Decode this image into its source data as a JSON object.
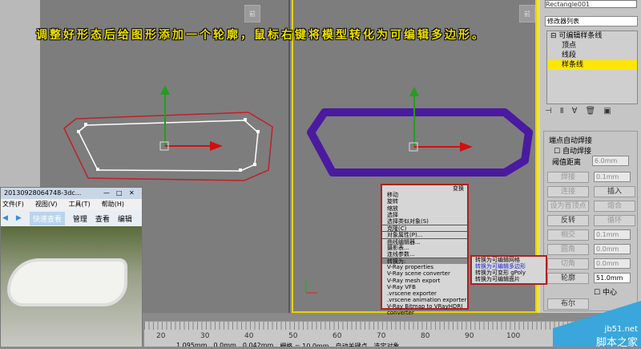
{
  "caption": "调整好形态后给图形添加一个轮廓，鼠标右键将模型转化为可编辑多边形。",
  "viewport_icon": "前",
  "panel": {
    "object_name": "Rectangle001",
    "modifier_list": "修改器列表",
    "stack": [
      {
        "label": "可编辑样条线"
      },
      {
        "label": "顶点"
      },
      {
        "label": "线段"
      },
      {
        "label": "样条线",
        "selected": true
      }
    ],
    "weld_group": "端点自动焊接",
    "auto_weld": "自动焊接",
    "threshold_label": "阈值距离",
    "threshold_value": "6.0mm",
    "buttons": {
      "weld": "焊接",
      "weld_val": "0.1mm",
      "connect": "连接",
      "insert": "插入",
      "make_first": "设为首顶点",
      "fuse": "熔合",
      "reverse": "反转",
      "cycle": "循环",
      "cross": "相交",
      "cross_val": "0.1mm",
      "fillet": "圆角",
      "fillet_val": "0.0mm",
      "chamfer": "切角",
      "chamfer_val": "0.0mm",
      "outline": "轮廓",
      "outline_val": "51.0mm",
      "center": "中心",
      "boolean": "布尔"
    }
  },
  "menu": {
    "header": "变换",
    "items": [
      "移动",
      "旋转",
      "缩放",
      "选择",
      "选择类似对象(S)",
      "克隆(C)",
      "对象属性(P)...",
      "曲线编辑器...",
      "摄影表...",
      "连线参数...",
      "转换为:",
      "V-Ray properties",
      "V-Ray scene converter",
      "V-Ray mesh export",
      "V-Ray VFB",
      ".vrscene exporter",
      ".vrscene animation exporter",
      "V-Ray Bitmap to VRayHDRI converter"
    ],
    "submenu": [
      "转换为可编辑网格",
      "转换为可编辑多边形",
      "转换为可变形 gPoly",
      "转换为可编辑面片"
    ]
  },
  "timeline": {
    "ticks": [
      "20",
      "30",
      "40",
      "50",
      "60",
      "70",
      "80",
      "90",
      "100"
    ],
    "x": "1.095mm",
    "y": "0.0mm",
    "z": "0.042mm",
    "grid": "栅格 = 10.0mm",
    "autokey": "自动关键点",
    "selected": "选定对象"
  },
  "window": {
    "title": "20130928064748-3dc...",
    "menu": [
      "文件(F)",
      "视图(V)",
      "工具(T)",
      "帮助(H)"
    ],
    "toolbar": [
      "快速查看",
      "管理",
      "查看",
      "编辑"
    ]
  },
  "watermark": {
    "site": "jb51.net",
    "name": "脚本之家"
  },
  "colors": {
    "outline": "#4a1aa0",
    "selection": "#ffe600",
    "menu_border": "#b02020"
  }
}
